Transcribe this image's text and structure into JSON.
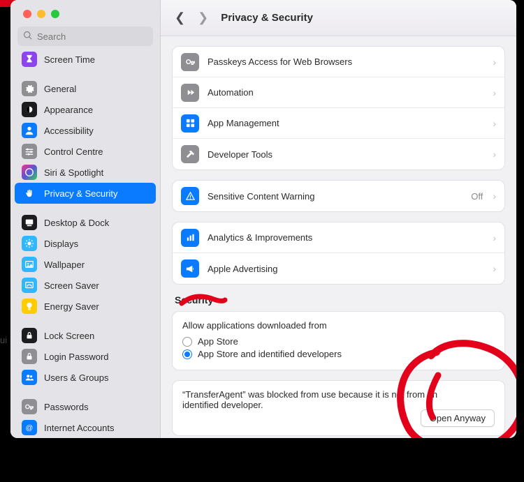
{
  "window": {
    "title": "Privacy & Security"
  },
  "search": {
    "placeholder": "Search"
  },
  "edge_text": "ui",
  "sidebar": {
    "items": [
      {
        "label": "Screen Time",
        "icon": "hourglass-icon",
        "color": "ic-purple"
      },
      {
        "label": "General",
        "icon": "gear-icon",
        "color": "ic-gray"
      },
      {
        "label": "Appearance",
        "icon": "appearance-icon",
        "color": "ic-black"
      },
      {
        "label": "Accessibility",
        "icon": "person-icon",
        "color": "ic-blue"
      },
      {
        "label": "Control Centre",
        "icon": "sliders-icon",
        "color": "ic-gray"
      },
      {
        "label": "Siri & Spotlight",
        "icon": "siri-icon",
        "color": "ic-multi"
      },
      {
        "label": "Privacy & Security",
        "icon": "hand-icon",
        "color": "ic-blue",
        "selected": true
      },
      {
        "label": "Desktop & Dock",
        "icon": "dock-icon",
        "color": "ic-black"
      },
      {
        "label": "Displays",
        "icon": "sun-icon",
        "color": "ic-cyan"
      },
      {
        "label": "Wallpaper",
        "icon": "wallpaper-icon",
        "color": "ic-cyan"
      },
      {
        "label": "Screen Saver",
        "icon": "screensaver-icon",
        "color": "ic-cyan"
      },
      {
        "label": "Energy Saver",
        "icon": "bulb-icon",
        "color": "ic-yellow"
      },
      {
        "label": "Lock Screen",
        "icon": "lock-icon",
        "color": "ic-black"
      },
      {
        "label": "Login Password",
        "icon": "lock-icon",
        "color": "ic-gray"
      },
      {
        "label": "Users & Groups",
        "icon": "users-icon",
        "color": "ic-blue"
      },
      {
        "label": "Passwords",
        "icon": "key-icon",
        "color": "ic-gray"
      },
      {
        "label": "Internet Accounts",
        "icon": "at-icon",
        "color": "ic-blue"
      }
    ],
    "breaks_after": [
      0,
      6,
      11,
      14
    ]
  },
  "groups": [
    {
      "rows": [
        {
          "label": "Passkeys Access for Web Browsers",
          "icon": "key-icon",
          "color": "ic-gray"
        },
        {
          "label": "Automation",
          "icon": "forward-icon",
          "color": "ic-gray"
        },
        {
          "label": "App Management",
          "icon": "apps-icon",
          "color": "ic-blue"
        },
        {
          "label": "Developer Tools",
          "icon": "hammer-icon",
          "color": "ic-gray"
        }
      ]
    },
    {
      "rows": [
        {
          "label": "Sensitive Content Warning",
          "icon": "warning-icon",
          "color": "ic-blue",
          "value": "Off"
        }
      ]
    },
    {
      "rows": [
        {
          "label": "Analytics & Improvements",
          "icon": "chart-icon",
          "color": "ic-blue"
        },
        {
          "label": "Apple Advertising",
          "icon": "megaphone-icon",
          "color": "ic-blue"
        }
      ]
    }
  ],
  "security": {
    "heading": "Security",
    "allow_title": "Allow applications downloaded from",
    "options": [
      {
        "label": "App Store",
        "checked": false
      },
      {
        "label": "App Store and identified developers",
        "checked": true
      }
    ],
    "blocked_text": "“TransferAgent” was blocked from use because it is not from an identified developer.",
    "open_anyway": "Open Anyway"
  },
  "annotations": {
    "color": "#e3001a"
  }
}
